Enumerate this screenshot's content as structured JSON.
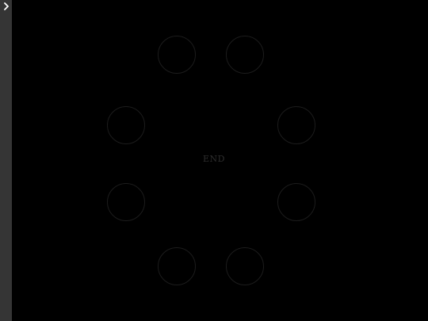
{
  "sidebar": {
    "toggle_icon": "chevron-right-icon",
    "toggle_glyph": "›",
    "background": "#353535"
  },
  "stage": {
    "background": "#000000",
    "center_label": "END",
    "targets": [
      {
        "label": ""
      },
      {
        "label": ""
      },
      {
        "label": ""
      },
      {
        "label": ""
      },
      {
        "label": ""
      },
      {
        "label": ""
      },
      {
        "label": ""
      },
      {
        "label": ""
      }
    ]
  }
}
